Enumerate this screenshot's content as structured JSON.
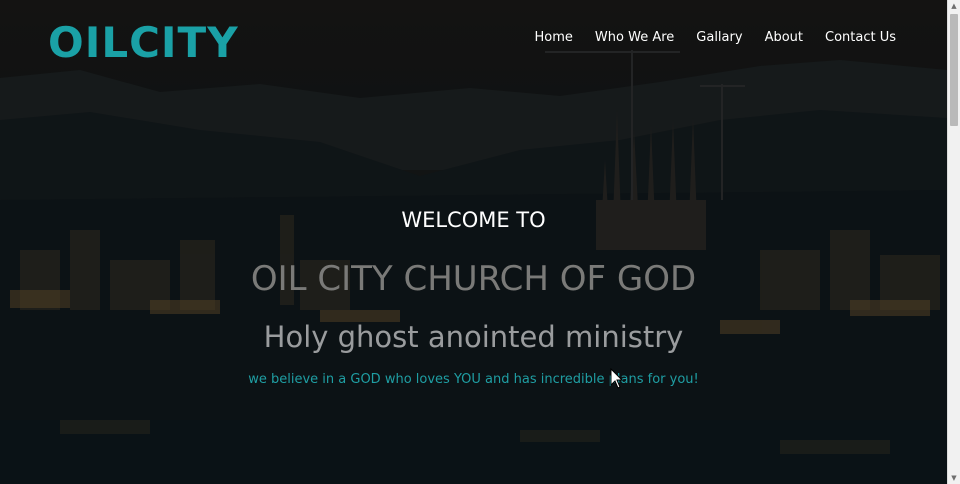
{
  "brand": {
    "logo": "OILCITY",
    "accent": "#1aa1a6"
  },
  "nav": {
    "items": [
      {
        "label": "Home"
      },
      {
        "label": "Who We Are"
      },
      {
        "label": "Gallary"
      },
      {
        "label": "About"
      },
      {
        "label": "Contact Us"
      }
    ]
  },
  "hero": {
    "welcome": "WELCOME TO",
    "title": "OIL CITY CHURCH OF GOD",
    "subtitle": "Holy ghost anointed ministry",
    "tagline": "we believe in a GOD who loves YOU and has incredible plans for you!"
  },
  "scrollbar": {
    "up_icon": "arrow-up-icon",
    "down_icon": "arrow-down-icon"
  }
}
